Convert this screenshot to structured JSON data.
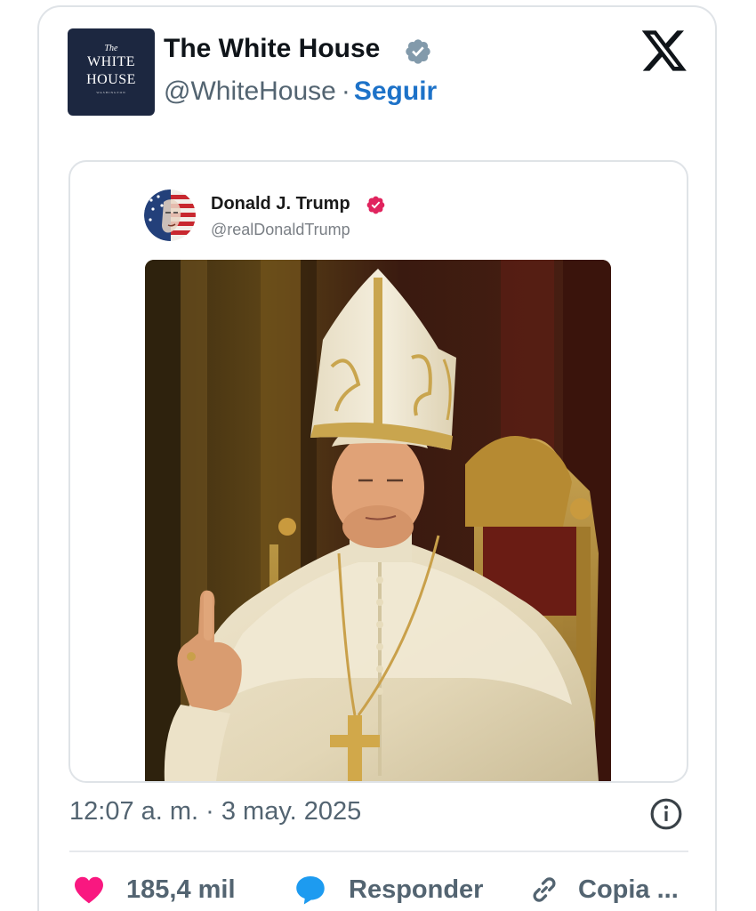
{
  "tweet": {
    "author": {
      "name": "The White House",
      "handle": "@WhiteHouse",
      "separator": "·",
      "follow_label": "Seguir",
      "avatar_text": {
        "the": "The",
        "line1": "WHITE",
        "line2": "HOUSE",
        "sub": "WASHINGTON"
      }
    },
    "quoted_post": {
      "name": "Donald J. Trump",
      "handle": "@realDonaldTrump"
    },
    "timestamp": "12:07 a. m. · 3 may. 2025",
    "actions": {
      "like_count": "185,4 mil",
      "reply_label": "Responder",
      "copy_label": "Copia ..."
    }
  },
  "colors": {
    "follow_blue": "#1d72c8",
    "like_pink": "#f91880",
    "reply_blue": "#1d9bf0",
    "verified_gray": "#829aab",
    "verified_pink": "#e0245e"
  },
  "icons": [
    "verified-badge-icon",
    "x-logo-icon",
    "info-icon",
    "heart-icon",
    "reply-bubble-icon",
    "link-icon"
  ]
}
